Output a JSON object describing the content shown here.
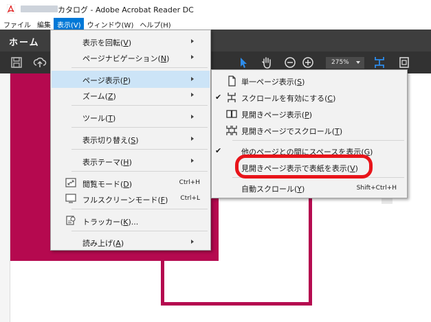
{
  "window": {
    "title": "カタログ - Adobe Acrobat Reader DC",
    "icon": "acrobat-icon"
  },
  "menubar": {
    "items": [
      {
        "label": "ファイル"
      },
      {
        "label": "編集"
      },
      {
        "label": "表示(V)",
        "active": true
      },
      {
        "label": "ウィンドウ(W)"
      },
      {
        "label": "ヘルプ(H)"
      }
    ]
  },
  "tabs": {
    "home": "ホーム"
  },
  "toolbar": {
    "zoom": "275%",
    "icons": [
      "save-icon",
      "upload-icon",
      "select-arrow-icon",
      "hand-icon",
      "zoom-out-icon",
      "zoom-in-icon",
      "scroll-mode-icon",
      "fit-page-icon"
    ]
  },
  "view_menu": {
    "items": [
      {
        "label": "表示を回転(",
        "mnemonic": "V",
        "close": ")",
        "submenu": true
      },
      {
        "label": "ページナビゲーション(",
        "mnemonic": "N",
        "close": ")",
        "submenu": true
      },
      {
        "label": "ページ表示(",
        "mnemonic": "P",
        "close": ")",
        "submenu": true,
        "highlighted": true
      },
      {
        "label": "ズーム(",
        "mnemonic": "Z",
        "close": ")",
        "submenu": true
      },
      {
        "label": "ツール(",
        "mnemonic": "T",
        "close": ")",
        "submenu": true
      },
      {
        "label": "表示切り替え(",
        "mnemonic": "S",
        "close": ")",
        "submenu": true
      },
      {
        "label": "表示テーマ(",
        "mnemonic": "H",
        "close": ")",
        "submenu": true
      },
      {
        "label": "閲覧モード(",
        "mnemonic": "D",
        "close": ")",
        "shortcut": "Ctrl+H",
        "icon": "reading-mode-icon"
      },
      {
        "label": "フルスクリーンモード(",
        "mnemonic": "F",
        "close": ")",
        "shortcut": "Ctrl+L",
        "icon": "full-screen-icon"
      },
      {
        "label": "トラッカー(",
        "mnemonic": "K",
        "close": ")...",
        "icon": "tracker-icon"
      },
      {
        "label": "読み上げ(",
        "mnemonic": "A",
        "close": ")",
        "submenu": true
      }
    ]
  },
  "page_display_submenu": {
    "items": [
      {
        "label": "単一ページ表示(",
        "mnemonic": "S",
        "close": ")",
        "icon": "single-page-icon"
      },
      {
        "label": "スクロールを有効にする(",
        "mnemonic": "C",
        "close": ")",
        "icon": "scroll-icon",
        "checked": true
      },
      {
        "label": "見開きページ表示(",
        "mnemonic": "P",
        "close": ")",
        "icon": "two-page-icon"
      },
      {
        "label": "見開きページでスクロール(",
        "mnemonic": "T",
        "close": ")",
        "icon": "two-page-scroll-icon"
      },
      {
        "label": "他のページとの間にスペースを表示(",
        "mnemonic": "G",
        "close": ")",
        "checked": true
      },
      {
        "label": "見開きページ表示で表紙を表示(",
        "mnemonic": "V",
        "close": ")",
        "annotated": true
      },
      {
        "label": "自動スクロール(",
        "mnemonic": "Y",
        "close": ")",
        "shortcut": "Shift+Ctrl+H"
      }
    ]
  },
  "colors": {
    "menu_highlight": "#cce4f7",
    "active_menu": "#0078d7",
    "document_magenta": "#b5094f",
    "annotation_red": "#e8141a"
  }
}
